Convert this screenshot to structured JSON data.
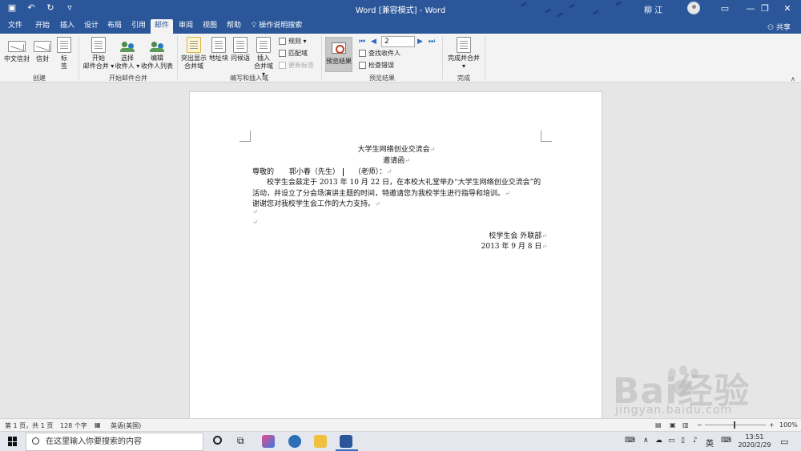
{
  "window": {
    "title": "Word [兼容模式]  -  Word",
    "user": "柳 江",
    "qat_icons": [
      "save-icon",
      "undo-icon",
      "redo-icon",
      "customize-icon"
    ],
    "controls": [
      "minimize",
      "restore",
      "close"
    ]
  },
  "tabs": [
    "文件",
    "开始",
    "插入",
    "设计",
    "布局",
    "引用",
    "邮件",
    "审阅",
    "视图",
    "帮助"
  ],
  "active_tab": "邮件",
  "tell_me": "操作说明搜索",
  "share": "共享",
  "ribbon": {
    "create": {
      "label": "创建",
      "chinese_envelope": "中文信封",
      "envelope": "信封",
      "labels": "标签"
    },
    "start_merge": {
      "label": "开始邮件合并",
      "start": [
        "开始",
        "邮件合并 ▾"
      ],
      "select": [
        "选择",
        "收件人 ▾"
      ],
      "edit": [
        "编辑",
        "收件人列表"
      ]
    },
    "write_insert": {
      "label": "编写和插入域",
      "highlight": [
        "突出显示",
        "合并域"
      ],
      "address": "地址块",
      "greeting": "问候语",
      "insert": [
        "插入",
        "合并域 ▾"
      ],
      "rules": "规则 ▾",
      "match": "匹配域",
      "update": "更新标签"
    },
    "preview": {
      "label": "预览结果",
      "preview_btn": "预览结果",
      "record": "2",
      "find": "查找收件人",
      "check": "检查错误"
    },
    "finish": {
      "label": "完成",
      "finish_btn": [
        "完成并合并",
        "▾"
      ]
    }
  },
  "document": {
    "org": "大学生网络创业交流会",
    "title": "邀请函",
    "salutation_prefix": "尊敬的",
    "recipient": "郭小春（先生）",
    "salutation_suffix": "（老师）：",
    "body1": "校学生会兹定于 2013 年 10 月 22 日，在本校大礼堂举办“大学生网络创业交流会”的",
    "body2": "活动，并设立了分会场演讲主题的时间，特邀请您为我校学生进行指导和培训。",
    "thanks": "谢谢您对我校学生会工作的大力支持。",
    "sign": "校学生会  外联部",
    "date": "2013 年 9 月 8 日",
    "para_mark": "↵"
  },
  "status": {
    "page": "第 1 页，共 1 页",
    "words": "128 个字",
    "lang": "英语(美国)",
    "zoom": "100%",
    "zoom_minus": "−",
    "zoom_plus": "+"
  },
  "taskbar": {
    "search": "在这里输入你要搜索的内容",
    "ime": "英",
    "time": "13:51",
    "date": "2020/2/29"
  },
  "watermark": {
    "text": "Bai经验",
    "url": "jingyan.baidu.com"
  },
  "colors": {
    "accent": "#2b579a",
    "ribbon": "#f3f3f3",
    "canvas": "#e6e6e6"
  }
}
